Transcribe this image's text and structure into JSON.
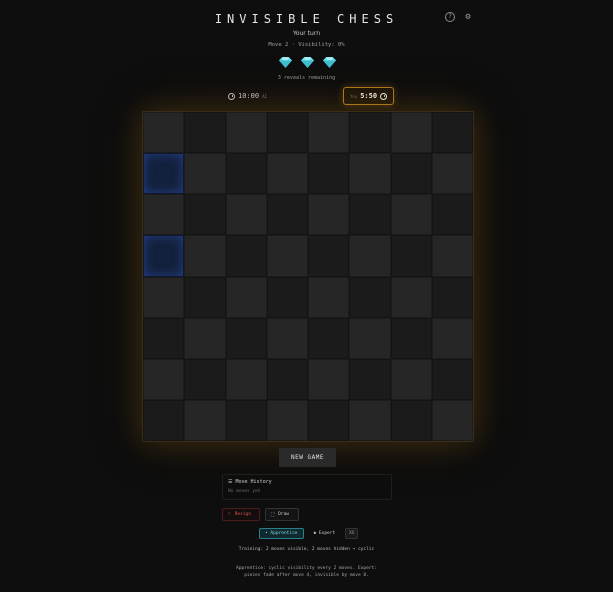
{
  "header": {
    "title": "INVISIBLE CHESS",
    "help_icon": "question-icon",
    "settings_icon": "gear-icon"
  },
  "status": {
    "turn": "Your turn",
    "move_visibility": "Move 2 · Visibility: 0%",
    "reveals": "3 reveals remaining",
    "gem_count": 3,
    "gem_color": "#6fe3ee"
  },
  "clocks": {
    "left_time": "10:00",
    "left_tag": "AI",
    "right_tag": "You",
    "right_time": "5:50"
  },
  "board": {
    "size": 8,
    "highlighted": [
      [
        1,
        0
      ],
      [
        3,
        0
      ]
    ],
    "light_color": "#262626",
    "dark_color": "#1b1b1b",
    "highlight_color": "#14213d"
  },
  "controls": {
    "new_game": "NEW GAME",
    "history_title": "Move History",
    "history_empty": "No moves yet",
    "resign": "Resign",
    "draw": "Draw"
  },
  "modes": {
    "apprentice": "• Apprentice",
    "expert": "◆ Expert",
    "extra": "XX"
  },
  "descriptions": {
    "training": "Training: 2 moves visible, 2 moves hidden → cyclic",
    "details": "Apprentice: cyclic visibility every 2 moves. Expert: pieces fade after move 4, invisible by move 8."
  }
}
